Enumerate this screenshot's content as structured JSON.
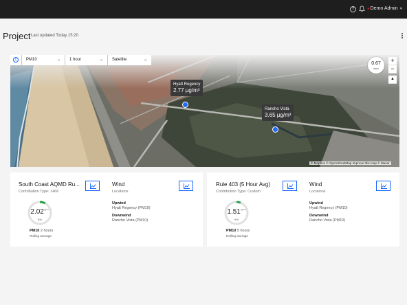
{
  "header": {
    "user_name": "Demo Admin",
    "help_icon": "help-icon",
    "notifications_icon": "bell-icon"
  },
  "page": {
    "title": "Project",
    "last_updated": "Last updated Today 15:20"
  },
  "map": {
    "pollutant": "PM10",
    "interval": "1 hour",
    "layer": "Satellite",
    "wind_speed": "0.67",
    "wind_unit": "mph",
    "zoom_in": "+",
    "zoom_out": "−",
    "compass": "▲",
    "attribution": "© Mapbox © OpenStreetMap Improve this map © Maxar",
    "sensors": [
      {
        "name": "Hyatt Regency",
        "value": "2.77 µg/m³"
      },
      {
        "name": "Rancho Vista",
        "value": "3.65 µg/m³"
      }
    ]
  },
  "cards": [
    {
      "title": "South Coast AQMD Ru...",
      "contribution": "Contribution Type: 1466",
      "gauge_value": "2.02",
      "gauge_unit": "µg/m³",
      "gauge_pct": "8%",
      "gauge_fraction": 0.08,
      "metric": "PM10",
      "metric_window": "2 hours",
      "avg_label": "Rolling average",
      "wind_title": "Wind",
      "wind_sub": "Locations",
      "upwind_label": "Upwind",
      "upwind_value": "Hyatt Regency (PM10)",
      "downwind_label": "Downwind",
      "downwind_value": "Rancho Vista (PM10)"
    },
    {
      "title": "Rule 403 (5 Hour Avg)",
      "contribution": "Contribution Type: Custom",
      "gauge_value": "1.51",
      "gauge_unit": "µg/m³",
      "gauge_pct": "6%",
      "gauge_fraction": 0.06,
      "metric": "PM10",
      "metric_window": "5 hours",
      "avg_label": "Rolling average",
      "wind_title": "Wind",
      "wind_sub": "Locations",
      "upwind_label": "Upwind",
      "upwind_value": "Hyatt Regency (PM10)",
      "downwind_label": "Downwind",
      "downwind_value": "Rancho Vista (PM10)"
    }
  ],
  "colors": {
    "accent": "#0f62fe",
    "gauge_fill": "#24a148",
    "gauge_track": "#e0e0e0",
    "marker": "#1f6aff"
  }
}
